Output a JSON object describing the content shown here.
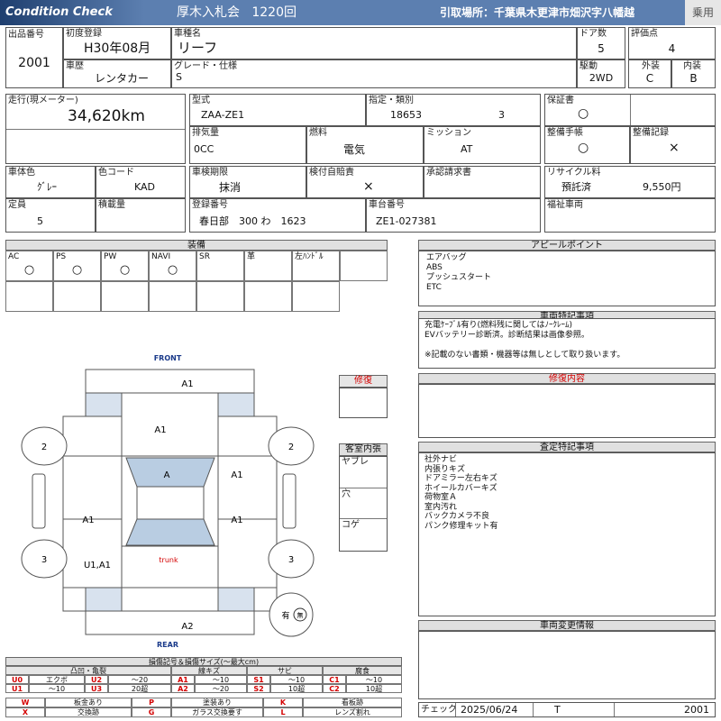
{
  "header": {
    "brand": "Condition Check",
    "auction": "厚木入札会",
    "session": "1220回",
    "pickup": "引取場所：千葉県木更津市畑沢字八幡越",
    "category": "乗用"
  },
  "top": {
    "lot_label": "出品番号",
    "lot": "2001",
    "first_reg_label": "初度登録",
    "first_reg": "H30年08月",
    "model_label": "車種名",
    "model": "リーフ",
    "doors_label": "ドア数",
    "doors": "5",
    "score_label": "評価点",
    "score": "4",
    "history_label": "車歴",
    "history": "レンタカー",
    "grade_label": "グレード・仕様",
    "grade": "S",
    "drive_label": "駆動",
    "drive": "2WD",
    "ext_label": "外装",
    "ext": "C",
    "int_label": "内装",
    "int": "B"
  },
  "mid": {
    "mileage_label": "走行(現メーター)",
    "mileage": "34,620km",
    "type_label": "型式",
    "type": "ZAA-ZE1",
    "designation_label": "指定・類別",
    "designation": "18653",
    "category_no": "3",
    "warranty_label": "保証書",
    "warranty": "○",
    "disp_label": "排気量",
    "disp": "0CC",
    "fuel_label": "燃料",
    "fuel": "電気",
    "mission_label": "ミッション",
    "mission": "AT",
    "manual_label": "整備手帳",
    "manual": "○",
    "record_label": "整備記録",
    "record": "×",
    "color_label": "車体色",
    "color": "ｸﾞﾚｰ",
    "colorcode_label": "色コード",
    "colorcode": "KAD",
    "inspect_label": "車検期限",
    "inspect": "抹消",
    "insurance_label": "検付自賠責",
    "insurance": "×",
    "approval_label": "承認請求書",
    "approval": "",
    "recycle_label": "リサイクル料",
    "recycle_status": "預託済",
    "recycle_fee": "9,550円",
    "capacity_label": "定員",
    "capacity": "5",
    "load_label": "積載量",
    "load": "",
    "plate_label": "登録番号",
    "plate": "春日部　300 わ　1623",
    "chassis_label": "車台番号",
    "chassis": "ZE1-027381",
    "welfare_label": "福祉車両",
    "welfare": ""
  },
  "equipment": {
    "title": "装備",
    "cols": [
      {
        "k": "AC",
        "v": "○"
      },
      {
        "k": "PS",
        "v": "○"
      },
      {
        "k": "PW",
        "v": "○"
      },
      {
        "k": "NAVI",
        "v": "○"
      },
      {
        "k": "SR",
        "v": ""
      },
      {
        "k": "革",
        "v": ""
      },
      {
        "k": "左ﾊﾝﾄﾞﾙ",
        "v": ""
      }
    ]
  },
  "appeal": {
    "title": "アピールポイント",
    "lines": [
      "エアバッグ",
      "ABS",
      "プッシュスタート",
      "ETC"
    ]
  },
  "special": {
    "title": "車両特記事項",
    "lines": [
      "充電ｹｰﾌﾞﾙ有り(燃料残に関してはﾉｰｸﾚｰﾑ)",
      "EVバッテリー診断済。診断結果は画像参照。",
      "",
      "※記載のない書類・機器等は無しとして取り扱います。"
    ]
  },
  "repair": {
    "title": "修復",
    "content_title": "修復内容"
  },
  "interior": {
    "title": "客室内張",
    "items": [
      "ヤブレ",
      "穴",
      "コゲ"
    ]
  },
  "assess": {
    "title": "査定特記事項",
    "lines": [
      "社外ナビ",
      "内張りキズ",
      "ドアミラー左右キズ",
      "ホイールカバーキズ",
      "荷物室Ａ",
      "室内汚れ",
      "バックカメラ不良",
      "パンク修理キット有"
    ]
  },
  "change": {
    "title": "車両変更情報"
  },
  "diagram": {
    "front": "FRONT",
    "rear": "REAR",
    "trunk": "trunk",
    "marks": {
      "front": "A1",
      "hood": "A1",
      "windshield": "A",
      "rdoor1": "A1",
      "rdoor2": "A1",
      "ldoor2": "A1",
      "rearleft": "U1,A1",
      "rear": "A2",
      "tire_fl": "2",
      "tire_fr": "2",
      "tire_rl": "3",
      "tire_rr": "3",
      "spare": "有",
      "spare_icon": "無"
    }
  },
  "legend": {
    "title": "損傷記号＆損傷サイズ(〜最大cm)",
    "h1": "凸凹・亀裂",
    "h2": "線キズ",
    "h3": "サビ",
    "h4": "腐食",
    "rows": [
      [
        [
          "U0",
          "エクボ"
        ],
        [
          "U2",
          "〜20"
        ],
        [
          "A1",
          "〜10"
        ],
        [
          "S1",
          "〜10"
        ],
        [
          "C1",
          "〜10"
        ]
      ],
      [
        [
          "U1",
          "〜10"
        ],
        [
          "U3",
          "20超"
        ],
        [
          "A2",
          "〜20"
        ],
        [
          "S2",
          "10超"
        ],
        [
          "C2",
          "10超"
        ]
      ]
    ],
    "rows2": [
      [
        [
          "W",
          "板金あり"
        ],
        [
          "P",
          "塗装あり"
        ],
        [
          "K",
          "看板跡"
        ]
      ],
      [
        [
          "X",
          "交換跡"
        ],
        [
          "G",
          "ガラス交換要す"
        ],
        [
          "L",
          "レンズ割れ"
        ]
      ]
    ]
  },
  "footer": {
    "check_label": "チェック",
    "date": "2025/06/24",
    "code": "T",
    "lot": "2001"
  }
}
